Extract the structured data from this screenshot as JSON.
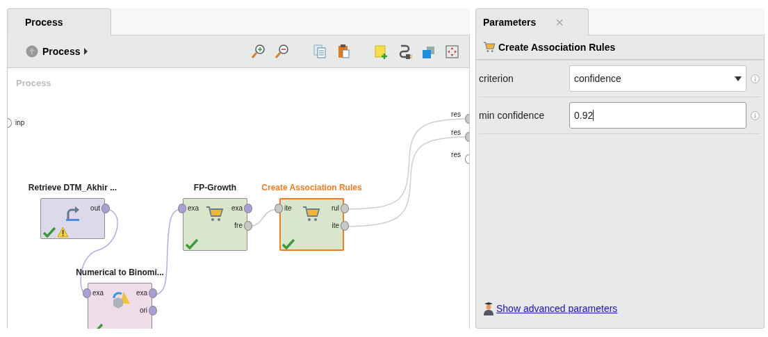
{
  "process_panel": {
    "tab": {
      "label": "Process",
      "selected": true
    },
    "breadcrumb": "Process",
    "canvas_title": "Process",
    "edge_ports": {
      "left": [
        {
          "label": "inp",
          "filled": false
        }
      ],
      "right": [
        {
          "label": "res",
          "filled": true
        },
        {
          "label": "res",
          "filled": true
        },
        {
          "label": "res",
          "filled": false
        }
      ]
    },
    "operators": [
      {
        "name": "Retrieve DTM_Akhir ...",
        "color": "#dcdaea",
        "selected": false,
        "ok": true,
        "warning": true,
        "outputs": [
          {
            "label": "out",
            "color": "#a89fd6"
          }
        ]
      },
      {
        "name": "FP-Growth",
        "color": "#d8e6cc",
        "selected": false,
        "ok": true,
        "warning": false,
        "inputs": [
          {
            "label": "exa",
            "color": "#a89fd6"
          }
        ],
        "outputs": [
          {
            "label": "exa",
            "color": "#a89fd6"
          },
          {
            "label": "fre",
            "color": "#c8c8c8"
          }
        ]
      },
      {
        "name": "Create Association Rules",
        "color": "#d8e6cc",
        "selected": true,
        "ok": true,
        "warning": false,
        "inputs": [
          {
            "label": "ite",
            "color": "#c8c8c8"
          }
        ],
        "outputs": [
          {
            "label": "rul",
            "color": "#c8c8c8"
          },
          {
            "label": "ite",
            "color": "#c8c8c8"
          }
        ]
      },
      {
        "name": "Numerical to Binomi...",
        "color": "#f0dbe8",
        "selected": false,
        "ok": true,
        "warning": false,
        "inputs": [
          {
            "label": "exa",
            "color": "#a89fd6"
          }
        ],
        "outputs": [
          {
            "label": "exa",
            "color": "#a89fd6"
          },
          {
            "label": "ori",
            "color": "#a89fd6"
          }
        ]
      }
    ]
  },
  "parameters_panel": {
    "tab": {
      "label": "Parameters",
      "close": "×",
      "selected": true
    },
    "operator": "Create Association Rules",
    "params": [
      {
        "kind": "select",
        "label": "criterion",
        "value": "confidence"
      },
      {
        "kind": "input",
        "label": "min confidence",
        "value": "0.92"
      }
    ],
    "advanced_link": "Show advanced parameters"
  }
}
